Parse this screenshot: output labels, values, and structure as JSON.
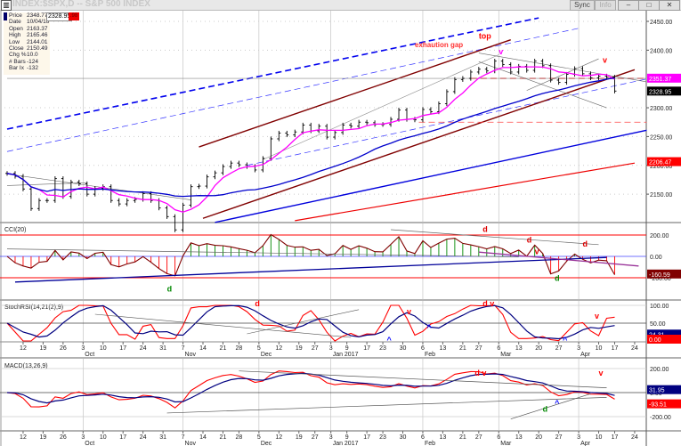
{
  "window": {
    "title": "INDEX:$SPX,D -- S&P 500 INDEX",
    "app_icon": "chart-icon",
    "sync_label": "Sync",
    "info_label": "Info",
    "minimize": "–",
    "maximize": "□",
    "close": "✕"
  },
  "info": {
    "rows": [
      {
        "k": "Price",
        "v": "2348.77"
      },
      {
        "k": "Date",
        "v": "10/04/16"
      },
      {
        "k": "Open",
        "v": "2163.37"
      },
      {
        "k": "High",
        "v": "2165.46"
      },
      {
        "k": "Low",
        "v": "2144.01"
      },
      {
        "k": "Close",
        "v": "2150.49"
      },
      {
        "k": "Chg %",
        "v": "10.0"
      },
      {
        "k": "# Bars",
        "v": "-124"
      },
      {
        "k": "Bar Ix",
        "v": "-132"
      }
    ],
    "cursor_price": "2328.95",
    "cursor_change": ".98"
  },
  "colors": {
    "price": "#000000",
    "ma_fast": "#ff00ff",
    "ma_slow": "#0000cc",
    "red": "#ff0000",
    "navy": "#000080",
    "brown": "#800000",
    "grid": "#aaaaaa"
  },
  "chart_data": {
    "type": "line",
    "title": "INDEX:$SPX,D -- S&P 500 INDEX",
    "sampling": "every 2 trading days, index 0 = 2016-09-06",
    "x_ticks": [
      {
        "d": 4,
        "label": "12"
      },
      {
        "d": 9,
        "label": "19"
      },
      {
        "d": 14,
        "label": "26"
      },
      {
        "d": 19,
        "label": "3",
        "month": "Oct"
      },
      {
        "d": 24,
        "label": "10"
      },
      {
        "d": 29,
        "label": "17"
      },
      {
        "d": 34,
        "label": "24"
      },
      {
        "d": 39,
        "label": "31"
      },
      {
        "d": 44,
        "label": "7",
        "month": "Nov"
      },
      {
        "d": 49,
        "label": "14"
      },
      {
        "d": 54,
        "label": "21"
      },
      {
        "d": 58,
        "label": "28"
      },
      {
        "d": 63,
        "label": "5",
        "month": "Dec"
      },
      {
        "d": 68,
        "label": "12"
      },
      {
        "d": 73,
        "label": "19"
      },
      {
        "d": 77,
        "label": "27"
      },
      {
        "d": 81,
        "label": "3",
        "month": "Jan 2017"
      },
      {
        "d": 85,
        "label": "9"
      },
      {
        "d": 90,
        "label": "17"
      },
      {
        "d": 94,
        "label": "23"
      },
      {
        "d": 99,
        "label": "30"
      },
      {
        "d": 104,
        "label": "6",
        "month": "Feb"
      },
      {
        "d": 109,
        "label": "13"
      },
      {
        "d": 114,
        "label": "21"
      },
      {
        "d": 118,
        "label": "27"
      },
      {
        "d": 123,
        "label": "6",
        "month": "Mar"
      },
      {
        "d": 128,
        "label": "13"
      },
      {
        "d": 133,
        "label": "20"
      },
      {
        "d": 138,
        "label": "27"
      },
      {
        "d": 143,
        "label": "3",
        "month": "Apr"
      },
      {
        "d": 148,
        "label": "10"
      },
      {
        "d": 152,
        "label": "17"
      },
      {
        "d": 157,
        "label": "24"
      }
    ],
    "price_axis": [
      "2450.00",
      "2400.00",
      "2300.00",
      "2250.00",
      "2200.00",
      "2150.00"
    ],
    "price_axis_values": [
      2450,
      2400,
      2300,
      2250,
      2200,
      2150
    ],
    "closes": [
      2186,
      2181,
      2159,
      2125,
      2139,
      2139,
      2177,
      2146,
      2171,
      2168,
      2150,
      2160,
      2163,
      2139,
      2133,
      2139,
      2141,
      2151,
      2139,
      2126,
      2111,
      2088,
      2131,
      2163,
      2164,
      2180,
      2187,
      2198,
      2204,
      2201,
      2198,
      2192,
      2212,
      2246,
      2256,
      2253,
      2258,
      2270,
      2260,
      2268,
      2249,
      2257,
      2270,
      2268,
      2275,
      2274,
      2271,
      2271,
      2280,
      2296,
      2280,
      2279,
      2297,
      2293,
      2307,
      2328,
      2349,
      2351,
      2362,
      2367,
      2364,
      2381,
      2375,
      2362,
      2372,
      2365,
      2381,
      2373,
      2348,
      2344,
      2358,
      2368,
      2359,
      2352,
      2355,
      2353,
      2329
    ],
    "price_tags": [
      {
        "value": "2351.37",
        "color": "#ff00ff",
        "fg": "#ffffff",
        "price": 2351.37
      },
      {
        "value": "2328.95",
        "color": "#000000",
        "fg": "#ffffff",
        "price": 2328.95
      },
      {
        "value": "2206.47",
        "color": "#ff0000",
        "fg": "#ffffff",
        "price": 2206.47
      }
    ],
    "trendlines": [
      {
        "d1": 0,
        "p1": 2263,
        "d2": 133,
        "p2": 2456,
        "color": "#0000ee",
        "dash": true,
        "w": 1.6
      },
      {
        "d1": 0,
        "p1": 2224,
        "d2": 143,
        "p2": 2438,
        "color": "#3333ff",
        "dash": true,
        "w": 0.7
      },
      {
        "d1": 60,
        "p1": 2200,
        "d2": 160,
        "p2": 2350,
        "color": "#3333ff",
        "dash": true,
        "w": 0.7
      },
      {
        "d1": 48,
        "p1": 2232,
        "d2": 126,
        "p2": 2418,
        "color": "#800000",
        "dash": false,
        "w": 1.4
      },
      {
        "d1": 49,
        "p1": 2108,
        "d2": 157,
        "p2": 2366,
        "color": "#800000",
        "dash": false,
        "w": 1.4
      },
      {
        "d1": 52,
        "p1": 2101,
        "d2": 160,
        "p2": 2261,
        "color": "#0000dd",
        "dash": false,
        "w": 1.4
      },
      {
        "d1": 72,
        "p1": 2104,
        "d2": 157,
        "p2": 2204,
        "color": "#ee0000",
        "dash": false,
        "w": 1.2
      },
      {
        "d1": 103,
        "p1": 2275,
        "d2": 160,
        "p2": 2275,
        "color": "#ff4444",
        "dash": true,
        "w": 0.8
      },
      {
        "d1": 116,
        "p1": 2351,
        "d2": 160,
        "p2": 2351,
        "color": "#ff8888",
        "dash": true,
        "w": 1.6
      },
      {
        "d1": 0,
        "p1": 2351,
        "d2": 160,
        "p2": 2351,
        "color": "#888888",
        "dash": false,
        "w": 0.6
      },
      {
        "d1": 0,
        "p1": 2185,
        "d2": 46,
        "p2": 2140,
        "color": "#666666",
        "dash": false,
        "w": 0.6
      },
      {
        "d1": 0,
        "p1": 2165,
        "d2": 20,
        "p2": 2170,
        "color": "#666666",
        "dash": false,
        "w": 0.6
      },
      {
        "d1": 64,
        "p1": 2210,
        "d2": 123,
        "p2": 2392,
        "color": "#888888",
        "dash": false,
        "w": 0.6
      },
      {
        "d1": 118,
        "p1": 2395,
        "d2": 160,
        "p2": 2345,
        "color": "#666666",
        "dash": false,
        "w": 0.6
      },
      {
        "d1": 118,
        "p1": 2380,
        "d2": 150,
        "p2": 2300,
        "color": "#666666",
        "dash": false,
        "w": 0.6
      },
      {
        "d1": 130,
        "p1": 2330,
        "d2": 148,
        "p2": 2385,
        "color": "#666666",
        "dash": false,
        "w": 0.6
      }
    ],
    "annotations": [
      {
        "panel": "price",
        "text": "exhaution gap",
        "d": 102,
        "v": 2405,
        "color": "#ff3333"
      },
      {
        "panel": "price",
        "text": "top",
        "d": 118,
        "v": 2420,
        "color": "#ff0000"
      },
      {
        "panel": "price",
        "text": "v",
        "d": 123,
        "v": 2393,
        "color": "#ff00ff"
      },
      {
        "panel": "price",
        "text": "v",
        "d": 149,
        "v": 2378,
        "color": "#ff0000"
      },
      {
        "panel": "cci",
        "text": "d",
        "d": 119,
        "v": 230,
        "color": "#dd0000"
      },
      {
        "panel": "cci",
        "text": "d",
        "d": 130,
        "v": 130,
        "color": "#dd0000"
      },
      {
        "panel": "cci",
        "text": "d",
        "d": 144,
        "v": 90,
        "color": "#dd0000"
      },
      {
        "panel": "cci",
        "text": "v",
        "d": 132,
        "v": 20,
        "color": "#dd0000"
      },
      {
        "panel": "cci",
        "text": "d",
        "d": 40,
        "v": -330,
        "color": "#008800"
      },
      {
        "panel": "cci",
        "text": "d",
        "d": 137,
        "v": -230,
        "color": "#008800"
      },
      {
        "panel": "stoch",
        "text": "d",
        "d": 62,
        "v": 98,
        "color": "#ff0000"
      },
      {
        "panel": "stoch",
        "text": "v",
        "d": 100,
        "v": 75,
        "color": "#ff0000"
      },
      {
        "panel": "stoch",
        "text": "d v",
        "d": 119,
        "v": 98,
        "color": "#ff0000"
      },
      {
        "panel": "stoch",
        "text": "v",
        "d": 147,
        "v": 62,
        "color": "#ff0000"
      },
      {
        "panel": "stoch",
        "text": "^",
        "d": 95,
        "v": -5,
        "color": "#0000ff"
      },
      {
        "panel": "stoch",
        "text": "^",
        "d": 105,
        "v": 30,
        "color": "#0000ff"
      },
      {
        "panel": "stoch",
        "text": "^",
        "d": 139,
        "v": -5,
        "color": "#0000ff"
      },
      {
        "panel": "macd",
        "text": "d v",
        "d": 117,
        "v": 140,
        "color": "#ff0000"
      },
      {
        "panel": "macd",
        "text": "v",
        "d": 148,
        "v": 140,
        "color": "#ff0000"
      },
      {
        "panel": "macd",
        "text": "d",
        "d": 134,
        "v": -160,
        "color": "#008800"
      },
      {
        "panel": "macd",
        "text": "^",
        "d": 137,
        "v": -110,
        "color": "#0000ff"
      }
    ],
    "cci": {
      "title": "CCI(20)",
      "axis": [
        "200.00",
        "0.00",
        "-200.00"
      ],
      "axis_values": [
        200,
        0,
        -200
      ],
      "tag": {
        "value": "-160.59",
        "color": "#800000"
      }
    },
    "stoch_rsi": {
      "title": "StochRSI(14,21(2),9)",
      "axis": [
        "100.00",
        "50.00"
      ],
      "axis_values": [
        100,
        50
      ],
      "tags": [
        {
          "value": "24.31",
          "color": "#000080"
        },
        {
          "value": "0.00",
          "color": "#ff0000"
        }
      ]
    },
    "macd": {
      "title": "MACD(13,26,9)",
      "axis": [
        "200.00",
        "0.00",
        "-200.00"
      ],
      "axis_values": [
        200,
        0,
        -200
      ],
      "tags": [
        {
          "value": "31.95",
          "color": "#000080"
        },
        {
          "value": "-93.51",
          "color": "#ff0000"
        }
      ]
    }
  }
}
